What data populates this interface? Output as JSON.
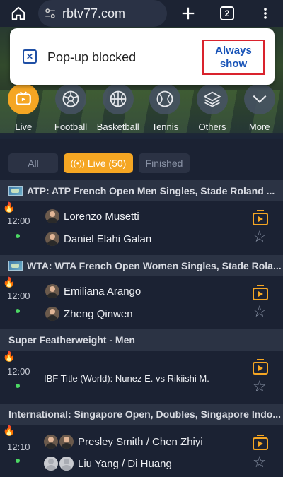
{
  "browser": {
    "url": "rbtv77.com",
    "tab_count": "2"
  },
  "popup": {
    "text": "Pop-up blocked",
    "action_line1": "Always",
    "action_line2": "show"
  },
  "sports": [
    {
      "label": "Live",
      "icon": "live-tv-icon"
    },
    {
      "label": "Football",
      "icon": "football-icon"
    },
    {
      "label": "Basketball",
      "icon": "basketball-icon"
    },
    {
      "label": "Tennis",
      "icon": "tennis-icon"
    },
    {
      "label": "Others",
      "icon": "layers-icon"
    },
    {
      "label": "More",
      "icon": "chevron-down-icon"
    }
  ],
  "filters": {
    "all": "All",
    "live": "Live (50)",
    "finished": "Finished"
  },
  "leagues": [
    {
      "name": "ATP: ATP French Open Men Singles, Stade Roland ...",
      "time": "12:00",
      "p1": "Lorenzo Musetti",
      "p2": "Daniel Elahi Galan"
    },
    {
      "name": "WTA: WTA French Open Women Singles, Stade Rola...",
      "time": "12:00",
      "p1": "Emiliana Arango",
      "p2": "Zheng Qinwen"
    },
    {
      "name": "Super Featherweight - Men",
      "time": "12:00",
      "event": "IBF Title (World): Nunez E. vs Rikiishi M."
    },
    {
      "name": "International: Singapore Open, Doubles, Singapore Indo...",
      "time": "12:10",
      "p1": "Presley Smith / Chen Zhiyi",
      "p2": "Liu Yang / Di Huang"
    }
  ],
  "colors": {
    "accent": "#f5a623",
    "live_dot": "#4cd964",
    "background": "#1b2233"
  }
}
